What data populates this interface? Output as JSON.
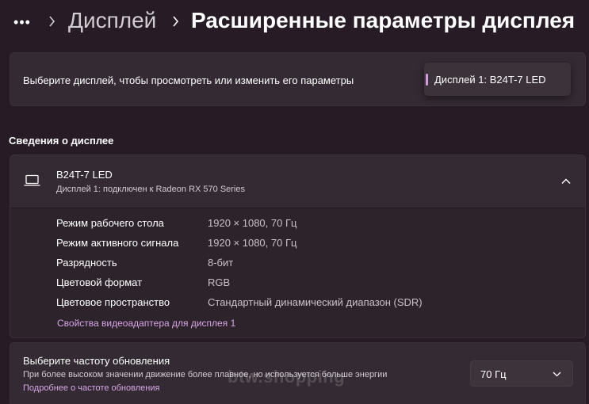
{
  "breadcrumb": {
    "more_label": "•••",
    "parent": "Дисплей",
    "current": "Расширенные параметры дисплея"
  },
  "display_select": {
    "label": "Выберите дисплей, чтобы просмотреть или изменить его параметры",
    "selected": "Дисплей 1: B24T-7 LED"
  },
  "info": {
    "section_title": "Сведения о дисплее",
    "name": "B24T-7 LED",
    "subtitle": "Дисплей 1: подключен к Radeon RX 570 Series",
    "rows": [
      {
        "label": "Режим рабочего стола",
        "value": "1920 × 1080, 70 Гц"
      },
      {
        "label": "Режим активного сигнала",
        "value": "1920 × 1080, 70 Гц"
      },
      {
        "label": "Разрядность",
        "value": "8-бит"
      },
      {
        "label": "Цветовой формат",
        "value": "RGB"
      },
      {
        "label": "Цветовое пространство",
        "value": "Стандартный динамический диапазон (SDR)"
      }
    ],
    "adapter_link": "Свойства видеоадаптера для дисплея 1"
  },
  "refresh": {
    "title": "Выберите частоту обновления",
    "description": "При более высоком значении движение более плавное, но используется больше энергии",
    "link": "Подробнее о частоте обновления",
    "selected": "70 Гц"
  },
  "watermark": "btw.shopping",
  "colors": {
    "background": "#271c25",
    "card": "#342a33",
    "accent": "#d29be0",
    "link": "#d6a6e6"
  },
  "icons": [
    "more-icon",
    "chevron-right-icon",
    "laptop-icon",
    "chevron-up-icon",
    "chevron-down-icon"
  ]
}
